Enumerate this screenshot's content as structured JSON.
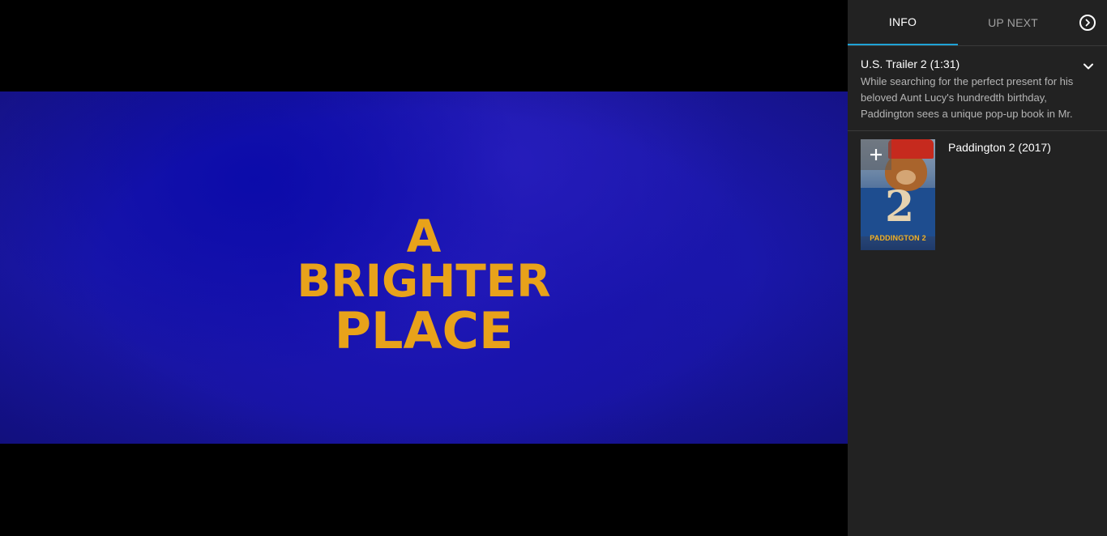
{
  "video": {
    "title_line1": "A BRIGHTER",
    "title_line2": "PLACE"
  },
  "panel": {
    "tabs": [
      {
        "label": "INFO",
        "active": true
      },
      {
        "label": "UP NEXT",
        "active": false
      }
    ],
    "next_icon": "chevron-circle-right-icon",
    "info": {
      "title": "U.S. Trailer 2 (1:31)",
      "description": "While searching for the perfect present for his beloved Aunt Lucy's hundredth birthday, Paddington sees a unique pop-up book in Mr.",
      "toggle_icon": "chevron-down-icon"
    },
    "related": [
      {
        "title": "Paddington 2 (2017)",
        "poster_text": "PADDINGTON 2",
        "poster_number": "2",
        "add_icon": "plus-icon"
      }
    ]
  },
  "colors": {
    "accent": "#1fa3d6",
    "panel_bg": "#222222",
    "title_card_text": "#e8a21a",
    "video_bg": "#1c18a8"
  }
}
